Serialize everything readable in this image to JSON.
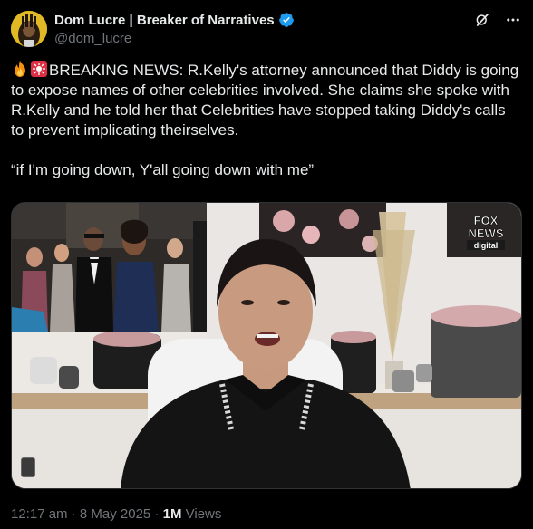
{
  "author": {
    "display_name": "Dom Lucre | Breaker of Narratives",
    "handle": "@dom_lucre",
    "verified": true
  },
  "header_icons": [
    "grok-icon",
    "more-icon"
  ],
  "tweet": {
    "line1": "BREAKING NEWS: R.Kelly's attorney announced that Diddy is going to expose names of other celebrities involved. She claims she spoke with R.Kelly and he told her that Celebrities have stopped taking Diddy's calls to prevent implicating theirselves.",
    "quote": "“if I'm going down, Y'all going down with me”",
    "emojis": [
      "fire-emoji",
      "siren-emoji"
    ]
  },
  "media": {
    "watermark_line1": "FOX",
    "watermark_line2": "NEWS",
    "watermark_line3": "digital"
  },
  "meta": {
    "time": "12:17 am",
    "date": "8 May 2025",
    "sep": "·",
    "views_count": "1M",
    "views_label": "Views"
  },
  "colors": {
    "background": "#000000",
    "text": "#e7e9ea",
    "secondary": "#71767b",
    "verified": "#1d9bf0"
  }
}
